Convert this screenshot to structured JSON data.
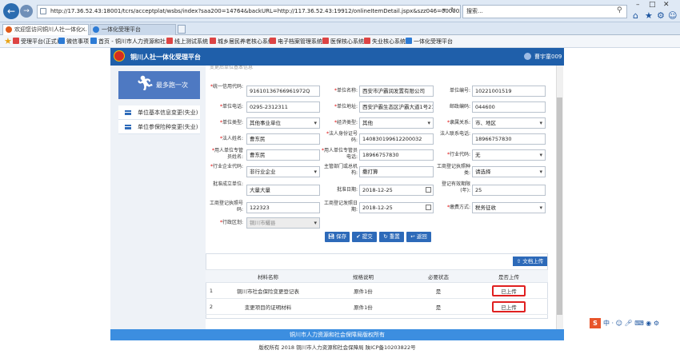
{
  "browser": {
    "url": "http://17.36.52.43:18001/tcrs/acceptplat/wsbs/index?saa200=14764&backURL=http://117.36.52.43:19912/onlineItemDetail.jspx&szz046=00000363&bs",
    "search_placeholder": "搜索...",
    "tabs": [
      {
        "label": "欢迎您访问铜川人社一体化..."
      },
      {
        "label": "一体化受理平台"
      }
    ],
    "favorites": [
      "受理平台(正式)",
      "微信事项",
      "首页 - 铜川市人力资源和社...",
      "线上测试系统",
      "城乡居民养老核心系统",
      "电子档案管理系统",
      "医保核心系统",
      "失业核心系统",
      "一体化受理平台"
    ]
  },
  "app": {
    "title": "铜川人社一体化受理平台",
    "user": "曹宇童009"
  },
  "sidebar": {
    "hero": "最多跑一次",
    "items": [
      {
        "label": "单位基本信息变更(失业)"
      },
      {
        "label": "单位参保险种变更(失业)"
      }
    ]
  },
  "form": {
    "section_title": "变更后单位基本信息",
    "fields": {
      "unified_code": {
        "label": "统一信用代码:",
        "value": "91610136766961972Q"
      },
      "unit_name": {
        "label": "单位名称:",
        "value": "西安市沪霸润发置有限公司"
      },
      "unit_no": {
        "label": "单位编号:",
        "value": "10221001519"
      },
      "unit_phone": {
        "label": "单位电话:",
        "value": "0295-2312311"
      },
      "unit_address": {
        "label": "单位地址:",
        "value": "西安沪霸生态区沪霸大道1号21"
      },
      "postcode": {
        "label": "邮政编码:",
        "value": "044600"
      },
      "unit_type": {
        "label": "单位类型:",
        "value": "其他事业单位"
      },
      "econ_type": {
        "label": "经济类型:",
        "value": "其他"
      },
      "affiliation": {
        "label": "隶属关系:",
        "value": "市、地区"
      },
      "legal_name": {
        "label": "法人姓名:",
        "value": "曹东民"
      },
      "legal_id": {
        "label": "法人身份证号码:",
        "value": "140830199612200032"
      },
      "legal_phone": {
        "label": "法人联系电话:",
        "value": "18966757830"
      },
      "employer_agent": {
        "label": "用人单位专管员姓名:",
        "value": "曹东民"
      },
      "employer_phone": {
        "label": "用人单位专管员电话:",
        "value": "18966757830"
      },
      "industry_code": {
        "label": "行业代码:",
        "value": "无"
      },
      "industry_type": {
        "label": "行业企业代码:",
        "value": "非行业企业"
      },
      "competent_dept": {
        "label": "主管部门或总机构:",
        "value": "撒打算"
      },
      "reg_authority": {
        "label": "工商登记执照种类:",
        "value": "请选择"
      },
      "approval_unit": {
        "label": "批准成立单位:",
        "value": "大量大量"
      },
      "approval_date": {
        "label": "批准日期:",
        "value": "2018-12-25"
      },
      "reg_validity": {
        "label": "登记有效期限(年):",
        "value": "25"
      },
      "license_no": {
        "label": "工商登记执照号码:",
        "value": "122323"
      },
      "license_date": {
        "label": "工商登记发照日期:",
        "value": "2018-12-25"
      },
      "collect_method": {
        "label": "缴费方式:",
        "value": "税务征收"
      },
      "admin_area": {
        "label": "行政区划:",
        "value": "铜川市耀县"
      }
    },
    "buttons": {
      "save": "保存",
      "submit": "提交",
      "reset": "重置",
      "back": "返回"
    }
  },
  "files": {
    "upload_button": "文档上传",
    "headers": [
      "",
      "材料名称",
      "规格说明",
      "必要状态",
      "是否上传"
    ],
    "rows": [
      {
        "index": "1",
        "name": "铜川市社会保险变更登记表",
        "spec": "原件1份",
        "required": "是",
        "status": "已上传"
      },
      {
        "index": "2",
        "name": "变更项目的证明材料",
        "spec": "原件1份",
        "required": "是",
        "status": "已上传"
      }
    ]
  },
  "footer": {
    "bar": "铜川市人力资源和社会保障局版权所有",
    "text": "版权所有 2018 铜川市人力资源和社会保障局 陕ICP备10203822号"
  }
}
